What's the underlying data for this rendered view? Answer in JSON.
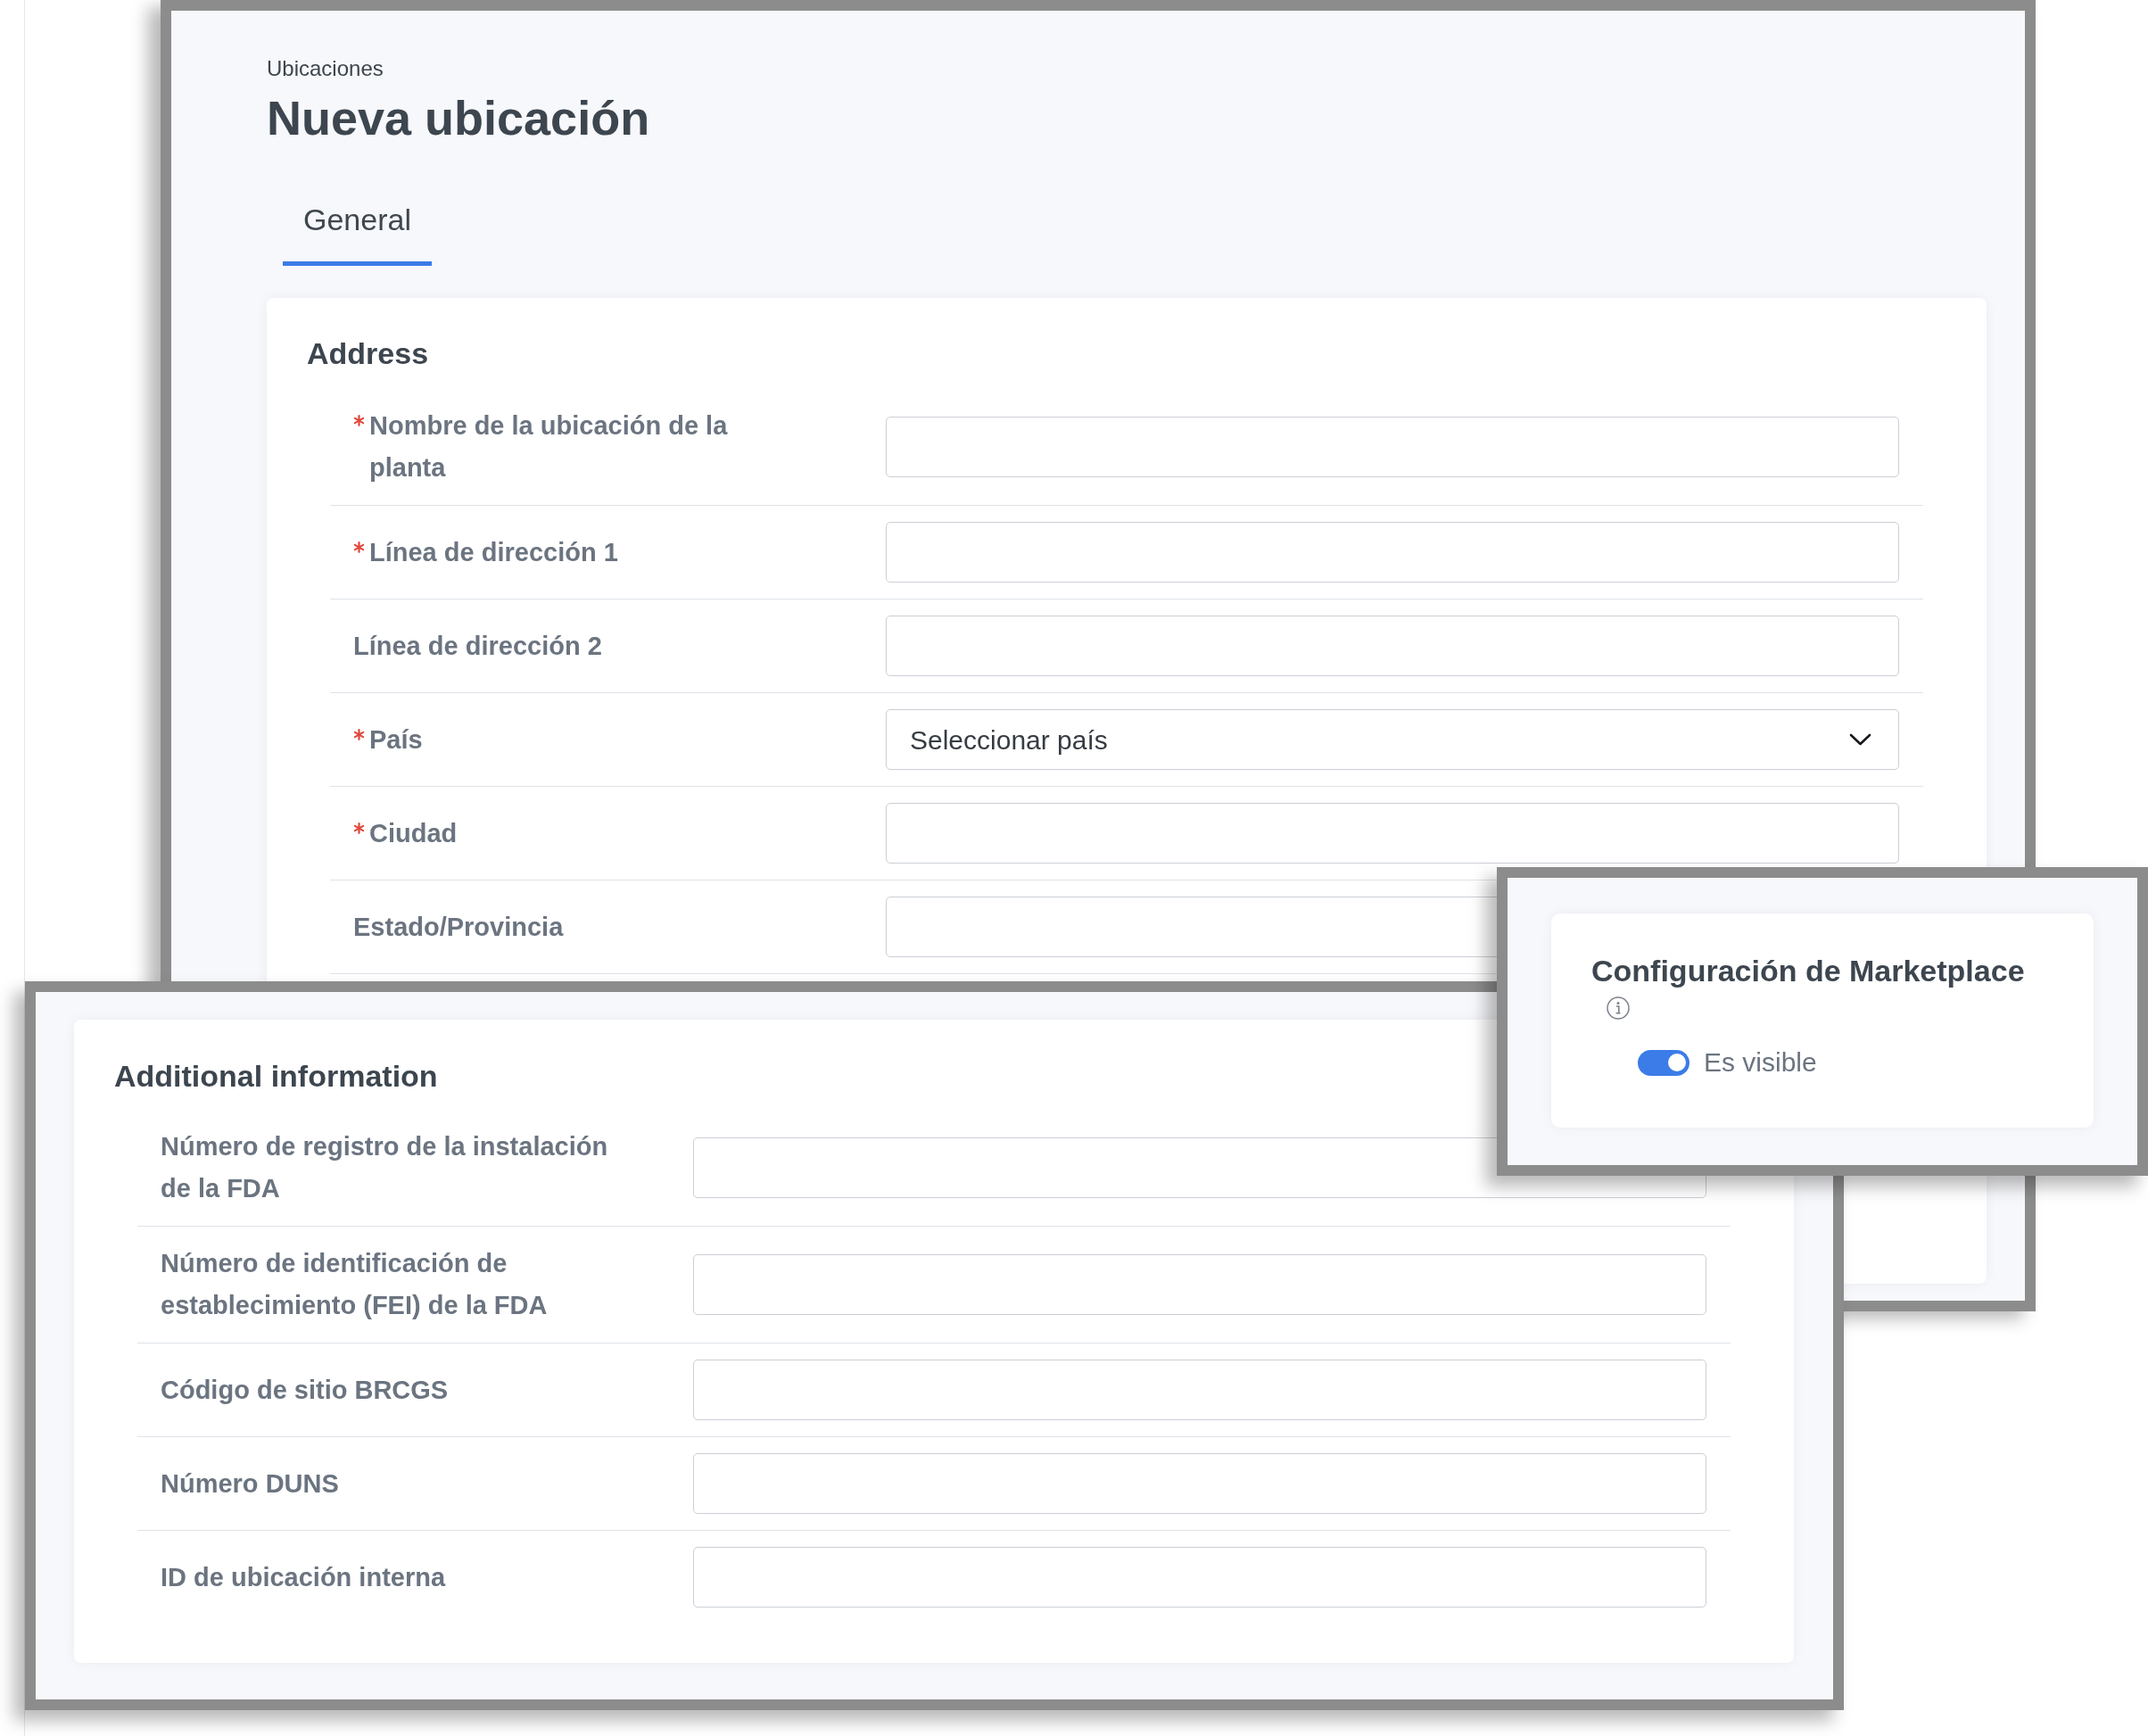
{
  "location_window": {
    "breadcrumb": "Ubicaciones",
    "title": "Nueva ubicación",
    "tabs": [
      {
        "label": "General",
        "selected": true
      }
    ],
    "address": {
      "heading": "Address",
      "fields": [
        {
          "label": "Nombre de la ubicación de la planta",
          "required": true,
          "kind": "text"
        },
        {
          "label": "Línea de dirección 1",
          "required": true,
          "kind": "text"
        },
        {
          "label": "Línea de dirección 2",
          "required": false,
          "kind": "text"
        },
        {
          "label": "País",
          "required": true,
          "kind": "select",
          "placeholder": "Seleccionar país"
        },
        {
          "label": "Ciudad",
          "required": true,
          "kind": "text"
        },
        {
          "label": "Estado/Provincia",
          "required": false,
          "kind": "text"
        }
      ]
    }
  },
  "additional_window": {
    "heading": "Additional information",
    "fields": [
      {
        "label": "Número de registro de la instalación de la FDA"
      },
      {
        "label": "Número de identificación de establecimiento (FEI) de la FDA"
      },
      {
        "label": "Código de sitio BRCGS"
      },
      {
        "label": "Número DUNS"
      },
      {
        "label": "ID de ubicación interna"
      }
    ]
  },
  "marketplace_window": {
    "heading": "Configuración de Marketplace",
    "toggle": {
      "label": "Es visible",
      "on": true
    }
  }
}
